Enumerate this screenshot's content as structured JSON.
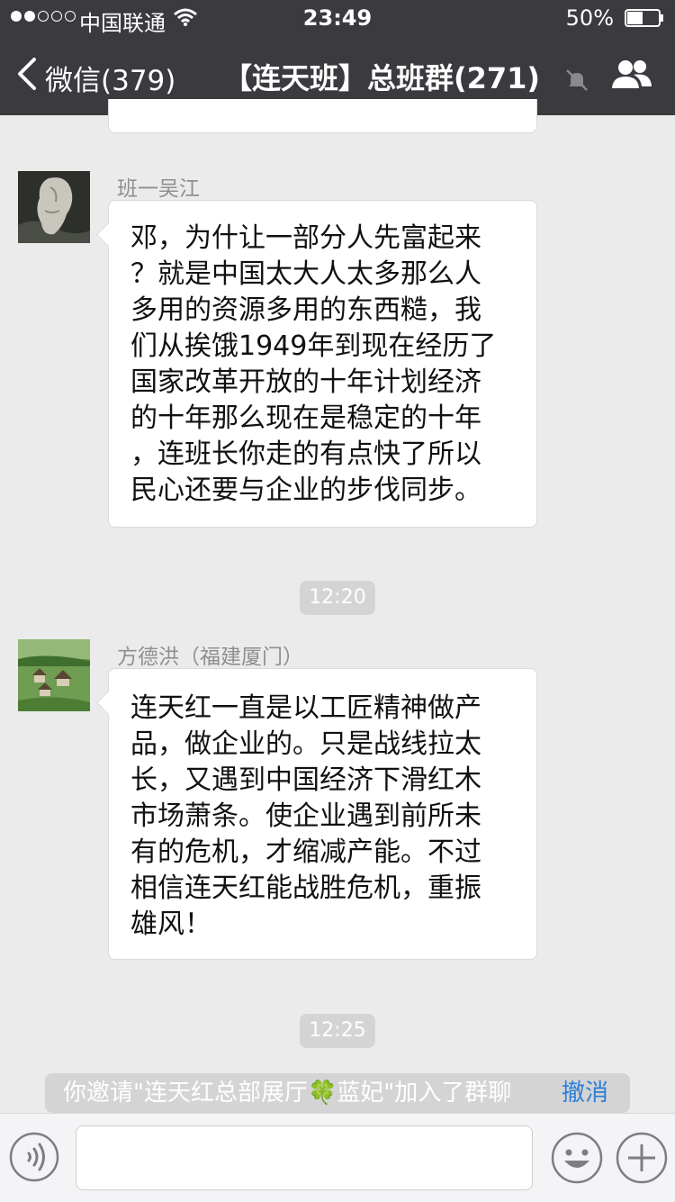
{
  "status_bar": {
    "carrier": "中国联通",
    "time": "23:49",
    "battery_percent": "50%",
    "battery_level": 0.5,
    "signal_bars_filled": 2,
    "signal_bars_total": 5
  },
  "nav": {
    "back_label": "微信(379)",
    "title": "【连天班】总班群(271)"
  },
  "messages": [
    {
      "sender": "班一吴江",
      "text": "邓，为什让一部分人先富起来\n？就是中国太大人太多那么人\n多用的资源多用的东西糙，我\n们从挨饿1949年到现在经历了\n国家改革开放的十年计划经济\n的十年那么现在是稳定的十年\n，连班长你走的有点快了所以\n民心还要与企业的步伐同步。"
    },
    {
      "sender": "方德洪（福建厦门）",
      "text": " 连天红一直是以工匠精神做产\n品，做企业的。只是战线拉太\n长，又遇到中国经济下滑红木\n市场萧条。使企业遇到前所未\n有的危机，才缩减产能。不过\n相信连天红能战胜危机，重振\n雄风！"
    }
  ],
  "timestamps": [
    "12:20",
    "12:25"
  ],
  "system_message": {
    "text": "你邀请\"连天红总部展厅🍀蓝妃\"加入了群聊",
    "action": "撤消"
  },
  "colors": {
    "header_bg": "#3b3a3f",
    "chat_bg": "#ebebeb",
    "bubble_bg": "#ffffff",
    "link_blue": "#2b7fd6",
    "time_pill_bg": "#d4d4d4"
  },
  "icons": {
    "back": "chevron-left-icon",
    "mute": "muted-bell-icon",
    "members": "people-icon",
    "voice": "voice-icon",
    "emoji": "emoji-icon",
    "more": "plus-icon"
  }
}
